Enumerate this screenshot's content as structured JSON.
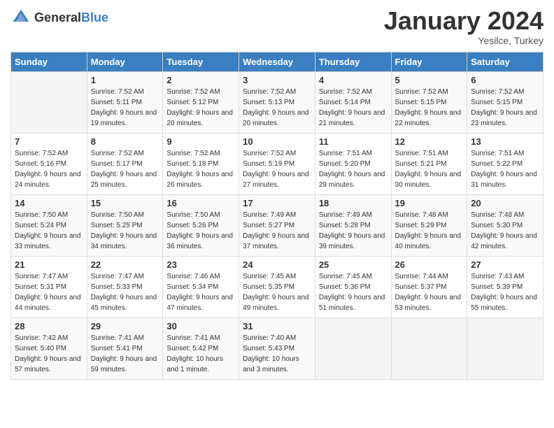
{
  "header": {
    "logo_general": "General",
    "logo_blue": "Blue",
    "month_title": "January 2024",
    "location": "Yesilce, Turkey"
  },
  "days_of_week": [
    "Sunday",
    "Monday",
    "Tuesday",
    "Wednesday",
    "Thursday",
    "Friday",
    "Saturday"
  ],
  "weeks": [
    [
      {
        "day": "",
        "sunrise": "",
        "sunset": "",
        "daylight": ""
      },
      {
        "day": "1",
        "sunrise": "Sunrise: 7:52 AM",
        "sunset": "Sunset: 5:11 PM",
        "daylight": "Daylight: 9 hours and 19 minutes."
      },
      {
        "day": "2",
        "sunrise": "Sunrise: 7:52 AM",
        "sunset": "Sunset: 5:12 PM",
        "daylight": "Daylight: 9 hours and 20 minutes."
      },
      {
        "day": "3",
        "sunrise": "Sunrise: 7:52 AM",
        "sunset": "Sunset: 5:13 PM",
        "daylight": "Daylight: 9 hours and 20 minutes."
      },
      {
        "day": "4",
        "sunrise": "Sunrise: 7:52 AM",
        "sunset": "Sunset: 5:14 PM",
        "daylight": "Daylight: 9 hours and 21 minutes."
      },
      {
        "day": "5",
        "sunrise": "Sunrise: 7:52 AM",
        "sunset": "Sunset: 5:15 PM",
        "daylight": "Daylight: 9 hours and 22 minutes."
      },
      {
        "day": "6",
        "sunrise": "Sunrise: 7:52 AM",
        "sunset": "Sunset: 5:15 PM",
        "daylight": "Daylight: 9 hours and 23 minutes."
      }
    ],
    [
      {
        "day": "7",
        "sunrise": "Sunrise: 7:52 AM",
        "sunset": "Sunset: 5:16 PM",
        "daylight": "Daylight: 9 hours and 24 minutes."
      },
      {
        "day": "8",
        "sunrise": "Sunrise: 7:52 AM",
        "sunset": "Sunset: 5:17 PM",
        "daylight": "Daylight: 9 hours and 25 minutes."
      },
      {
        "day": "9",
        "sunrise": "Sunrise: 7:52 AM",
        "sunset": "Sunset: 5:18 PM",
        "daylight": "Daylight: 9 hours and 26 minutes."
      },
      {
        "day": "10",
        "sunrise": "Sunrise: 7:52 AM",
        "sunset": "Sunset: 5:19 PM",
        "daylight": "Daylight: 9 hours and 27 minutes."
      },
      {
        "day": "11",
        "sunrise": "Sunrise: 7:51 AM",
        "sunset": "Sunset: 5:20 PM",
        "daylight": "Daylight: 9 hours and 29 minutes."
      },
      {
        "day": "12",
        "sunrise": "Sunrise: 7:51 AM",
        "sunset": "Sunset: 5:21 PM",
        "daylight": "Daylight: 9 hours and 30 minutes."
      },
      {
        "day": "13",
        "sunrise": "Sunrise: 7:51 AM",
        "sunset": "Sunset: 5:22 PM",
        "daylight": "Daylight: 9 hours and 31 minutes."
      }
    ],
    [
      {
        "day": "14",
        "sunrise": "Sunrise: 7:50 AM",
        "sunset": "Sunset: 5:24 PM",
        "daylight": "Daylight: 9 hours and 33 minutes."
      },
      {
        "day": "15",
        "sunrise": "Sunrise: 7:50 AM",
        "sunset": "Sunset: 5:25 PM",
        "daylight": "Daylight: 9 hours and 34 minutes."
      },
      {
        "day": "16",
        "sunrise": "Sunrise: 7:50 AM",
        "sunset": "Sunset: 5:26 PM",
        "daylight": "Daylight: 9 hours and 36 minutes."
      },
      {
        "day": "17",
        "sunrise": "Sunrise: 7:49 AM",
        "sunset": "Sunset: 5:27 PM",
        "daylight": "Daylight: 9 hours and 37 minutes."
      },
      {
        "day": "18",
        "sunrise": "Sunrise: 7:49 AM",
        "sunset": "Sunset: 5:28 PM",
        "daylight": "Daylight: 9 hours and 39 minutes."
      },
      {
        "day": "19",
        "sunrise": "Sunrise: 7:48 AM",
        "sunset": "Sunset: 5:29 PM",
        "daylight": "Daylight: 9 hours and 40 minutes."
      },
      {
        "day": "20",
        "sunrise": "Sunrise: 7:48 AM",
        "sunset": "Sunset: 5:30 PM",
        "daylight": "Daylight: 9 hours and 42 minutes."
      }
    ],
    [
      {
        "day": "21",
        "sunrise": "Sunrise: 7:47 AM",
        "sunset": "Sunset: 5:31 PM",
        "daylight": "Daylight: 9 hours and 44 minutes."
      },
      {
        "day": "22",
        "sunrise": "Sunrise: 7:47 AM",
        "sunset": "Sunset: 5:33 PM",
        "daylight": "Daylight: 9 hours and 45 minutes."
      },
      {
        "day": "23",
        "sunrise": "Sunrise: 7:46 AM",
        "sunset": "Sunset: 5:34 PM",
        "daylight": "Daylight: 9 hours and 47 minutes."
      },
      {
        "day": "24",
        "sunrise": "Sunrise: 7:45 AM",
        "sunset": "Sunset: 5:35 PM",
        "daylight": "Daylight: 9 hours and 49 minutes."
      },
      {
        "day": "25",
        "sunrise": "Sunrise: 7:45 AM",
        "sunset": "Sunset: 5:36 PM",
        "daylight": "Daylight: 9 hours and 51 minutes."
      },
      {
        "day": "26",
        "sunrise": "Sunrise: 7:44 AM",
        "sunset": "Sunset: 5:37 PM",
        "daylight": "Daylight: 9 hours and 53 minutes."
      },
      {
        "day": "27",
        "sunrise": "Sunrise: 7:43 AM",
        "sunset": "Sunset: 5:39 PM",
        "daylight": "Daylight: 9 hours and 55 minutes."
      }
    ],
    [
      {
        "day": "28",
        "sunrise": "Sunrise: 7:42 AM",
        "sunset": "Sunset: 5:40 PM",
        "daylight": "Daylight: 9 hours and 57 minutes."
      },
      {
        "day": "29",
        "sunrise": "Sunrise: 7:41 AM",
        "sunset": "Sunset: 5:41 PM",
        "daylight": "Daylight: 9 hours and 59 minutes."
      },
      {
        "day": "30",
        "sunrise": "Sunrise: 7:41 AM",
        "sunset": "Sunset: 5:42 PM",
        "daylight": "Daylight: 10 hours and 1 minute."
      },
      {
        "day": "31",
        "sunrise": "Sunrise: 7:40 AM",
        "sunset": "Sunset: 5:43 PM",
        "daylight": "Daylight: 10 hours and 3 minutes."
      },
      {
        "day": "",
        "sunrise": "",
        "sunset": "",
        "daylight": ""
      },
      {
        "day": "",
        "sunrise": "",
        "sunset": "",
        "daylight": ""
      },
      {
        "day": "",
        "sunrise": "",
        "sunset": "",
        "daylight": ""
      }
    ]
  ]
}
